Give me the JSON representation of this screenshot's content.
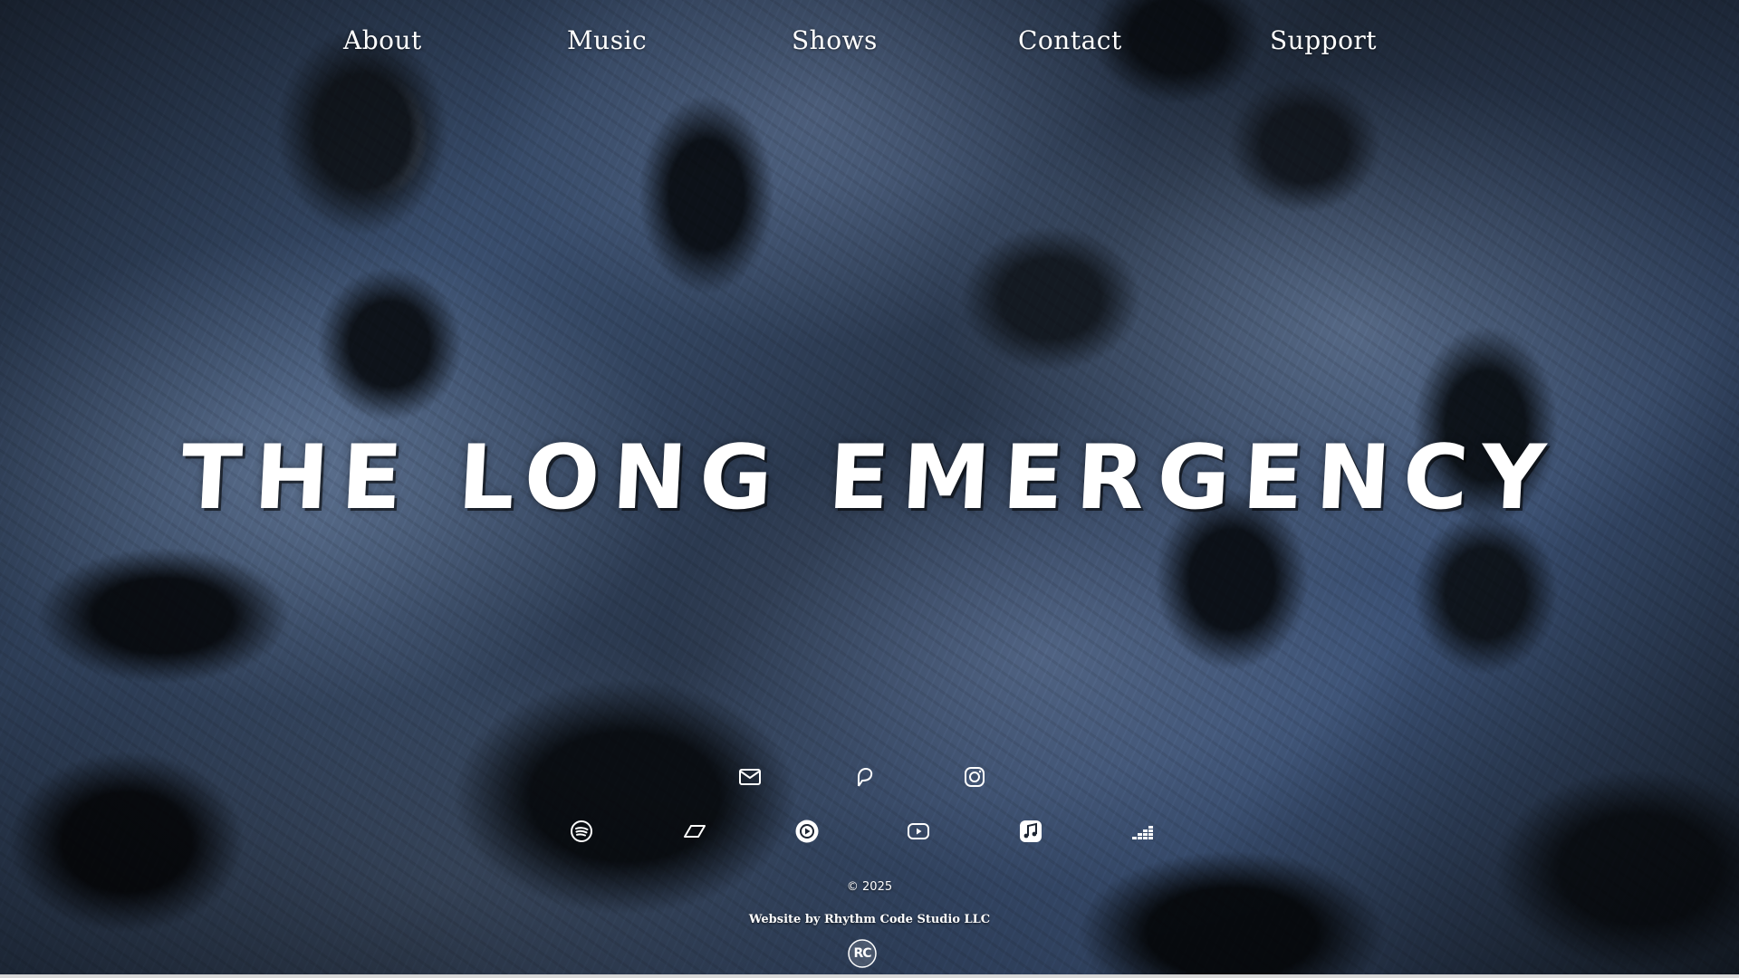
{
  "nav": {
    "items": [
      {
        "label": "About"
      },
      {
        "label": "Music"
      },
      {
        "label": "Shows"
      },
      {
        "label": "Contact"
      },
      {
        "label": "Support"
      }
    ]
  },
  "hero": {
    "title": "THE LONG EMERGENCY"
  },
  "social": {
    "row1": [
      {
        "icon": "email-icon"
      },
      {
        "icon": "patreon-icon"
      },
      {
        "icon": "instagram-icon"
      }
    ],
    "row2": [
      {
        "icon": "spotify-icon"
      },
      {
        "icon": "bandcamp-icon"
      },
      {
        "icon": "play-icon"
      },
      {
        "icon": "youtube-icon"
      },
      {
        "icon": "apple-music-icon"
      },
      {
        "icon": "deezer-icon"
      }
    ]
  },
  "footer": {
    "copyright": "© 2025",
    "credit": "Website by Rhythm Code Studio LLC",
    "logo_text": "RC"
  },
  "colors": {
    "text": "#ffffff",
    "background": "#2a3950"
  }
}
